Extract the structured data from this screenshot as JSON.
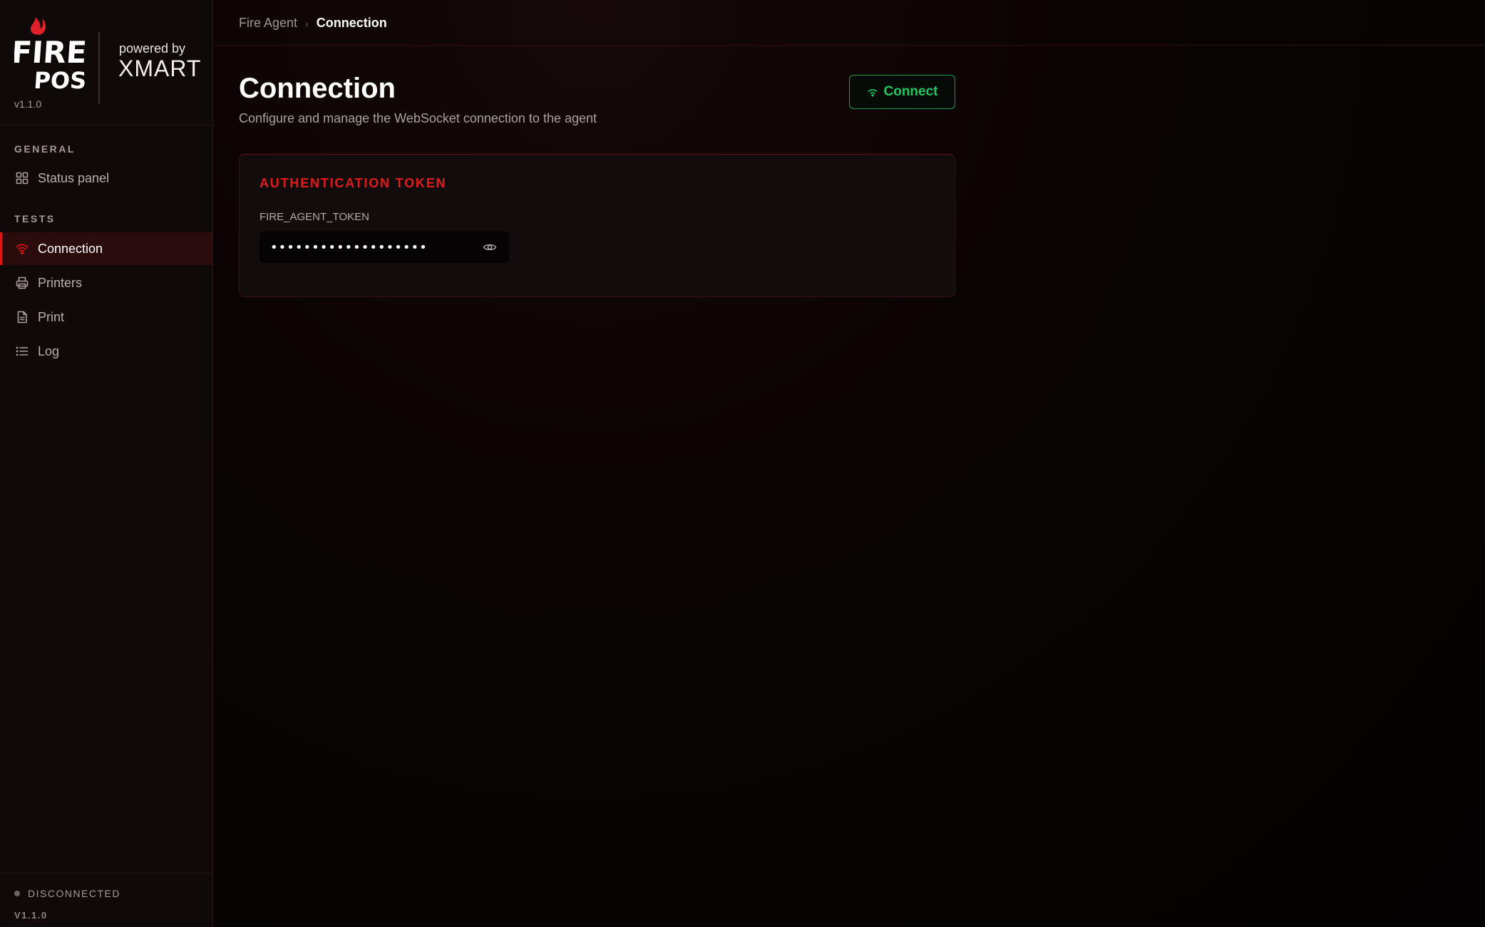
{
  "app": {
    "logo_text": "FIRE POS",
    "powered_by": "powered by",
    "partner": "XMART",
    "version": "v1.1.0"
  },
  "sidebar": {
    "sections": [
      {
        "label": "GENERAL",
        "items": [
          {
            "label": "Status panel",
            "icon": "grid-icon",
            "active": false
          }
        ]
      },
      {
        "label": "TESTS",
        "items": [
          {
            "label": "Connection",
            "icon": "wifi-icon",
            "active": true
          },
          {
            "label": "Printers",
            "icon": "printer-icon",
            "active": false
          },
          {
            "label": "Print",
            "icon": "document-icon",
            "active": false
          },
          {
            "label": "Log",
            "icon": "list-icon",
            "active": false
          }
        ]
      }
    ],
    "footer": {
      "status": "DISCONNECTED",
      "version": "V1.1.0"
    }
  },
  "header": {
    "breadcrumb": {
      "root": "Fire Agent",
      "separator": "›",
      "current": "Connection"
    }
  },
  "main": {
    "title": "Connection",
    "subtitle": "Configure and manage the WebSocket connection to the agent",
    "connect_button": {
      "label": "Connect",
      "icon": "wifi-icon"
    },
    "token_card": {
      "heading": "AUTHENTICATION TOKEN",
      "field_label": "FIRE_AGENT_TOKEN",
      "field_value": "•••••••••••••••••••",
      "toggle_icon": "eye-icon"
    }
  },
  "colors": {
    "accent_red": "#e01515",
    "connect_green": "#22c55e",
    "status_disconnected": "#6b6464"
  }
}
